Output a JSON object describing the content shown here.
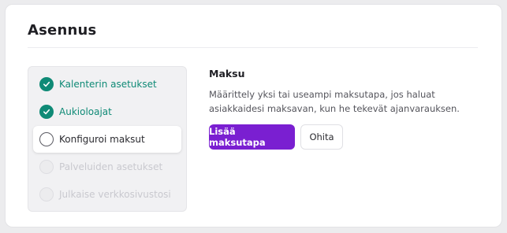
{
  "page": {
    "title": "Asennus"
  },
  "steps": [
    {
      "label": "Kalenterin asetukset",
      "state": "done"
    },
    {
      "label": "Aukioloajat",
      "state": "done"
    },
    {
      "label": "Konfiguroi maksut",
      "state": "active"
    },
    {
      "label": "Palveluiden asetukset",
      "state": "disabled"
    },
    {
      "label": "Julkaise verkkosivustosi",
      "state": "disabled"
    }
  ],
  "main": {
    "section_title": "Maksu",
    "description": "Määrittely yksi tai useampi maksutapa, jos haluat asiakkaidesi maksavan, kun he tekevät ajanvarauksen.",
    "add_button_label": "Lisää maksutapa",
    "skip_button_label": "Ohita"
  },
  "colors": {
    "accent": "#7a1fd1",
    "done": "#0f8a76",
    "disabled_text": "#c9c9cf"
  },
  "icons": {
    "done": "check-circle-icon",
    "pending": "empty-circle-icon",
    "disabled": "disabled-circle-icon"
  }
}
